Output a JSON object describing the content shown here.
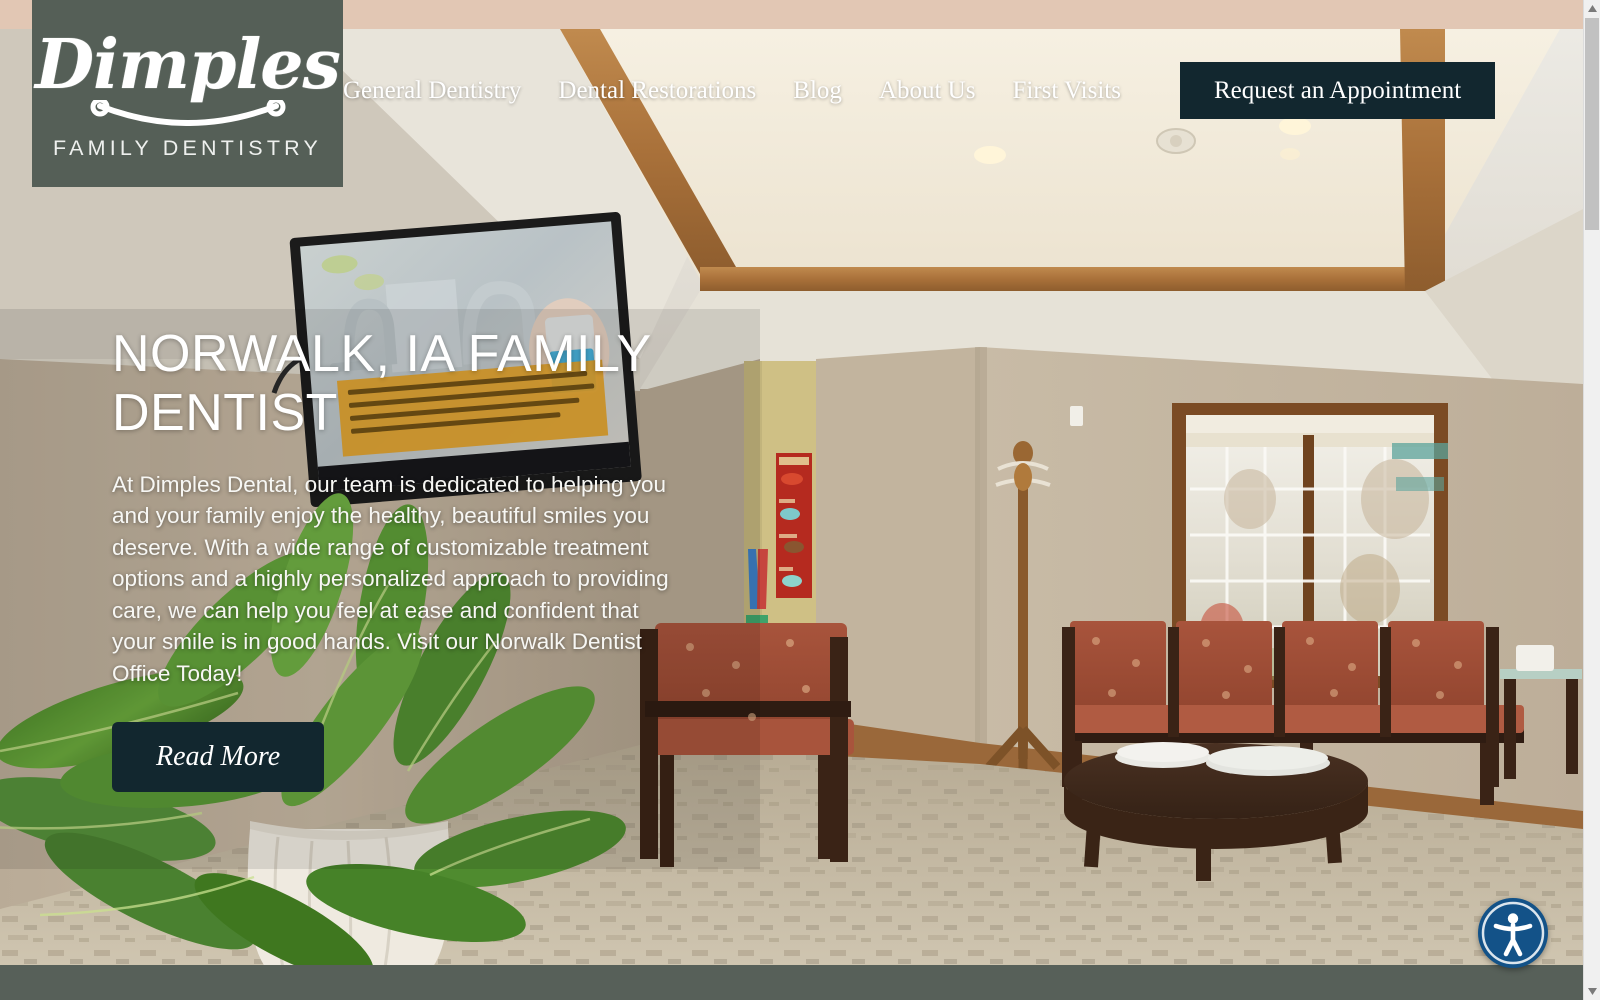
{
  "brand": {
    "name": "Dimples",
    "tagline": "FAMILY DENTISTRY",
    "logo_bg": "#555f57",
    "accent_dark": "#12272f",
    "footer_color": "#576059",
    "top_band_color": "#e2c7b4"
  },
  "nav": {
    "items": [
      {
        "label": "General Dentistry"
      },
      {
        "label": "Dental Restorations"
      },
      {
        "label": "Blog"
      },
      {
        "label": "About Us"
      },
      {
        "label": "First Visits"
      }
    ],
    "cta": {
      "label": "Request an Appointment"
    }
  },
  "hero": {
    "title": "NORWALK, IA FAMILY DENTIST",
    "paragraph": "At Dimples Dental, our team is dedicated to helping you and your family enjoy the healthy, beautiful smiles you deserve. With a wide range of customizable treatment options and a highly personalized approach to providing care, we can help you feel at ease and confident that your smile is in good hands. Visit our Norwalk Dentist Office Today!",
    "button": {
      "label": "Read More"
    },
    "image_alt": "Dental office waiting room with wall-mounted TV, potted plant, upholstered chairs, oval coffee table and a window"
  },
  "widgets": {
    "accessibility": {
      "icon": "accessibility-person-icon",
      "color": "#135288"
    }
  },
  "browser": {
    "scrollbar": {
      "up_arrow": "▲",
      "down_arrow": "▼"
    }
  }
}
